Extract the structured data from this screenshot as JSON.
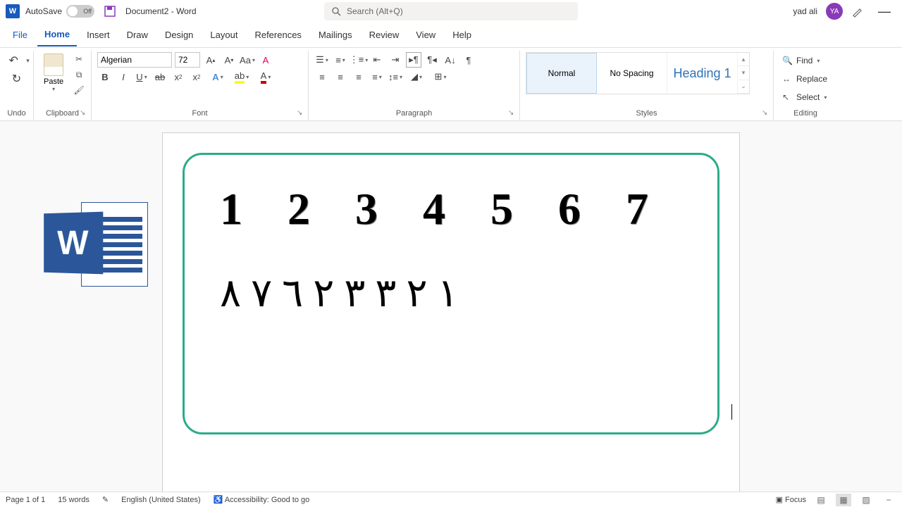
{
  "titlebar": {
    "autosave_label": "AutoSave",
    "autosave_state": "Off",
    "doc_title": "Document2  -  Word",
    "search_placeholder": "Search (Alt+Q)",
    "username": "yad ali",
    "avatar_initials": "YA"
  },
  "tabs": {
    "file": "File",
    "home": "Home",
    "insert": "Insert",
    "draw": "Draw",
    "design": "Design",
    "layout": "Layout",
    "references": "References",
    "mailings": "Mailings",
    "review": "Review",
    "view": "View",
    "help": "Help"
  },
  "ribbon": {
    "undo_label": "Undo",
    "clipboard_label": "Clipboard",
    "paste_label": "Paste",
    "font_label": "Font",
    "font_name": "Algerian",
    "font_size": "72",
    "paragraph_label": "Paragraph",
    "styles_label": "Styles",
    "style_normal": "Normal",
    "style_nospacing": "No Spacing",
    "style_heading1": "Heading 1",
    "editing_label": "Editing",
    "find": "Find",
    "replace": "Replace",
    "select": "Select"
  },
  "document": {
    "line1": "1 2 3 4 5 6 7",
    "line2": "١ ٢ ٣ ٣ ٢ ٦ ٧ ٨",
    "logo_letter": "W"
  },
  "statusbar": {
    "page": "Page 1 of 1",
    "words": "15 words",
    "language": "English (United States)",
    "accessibility": "Accessibility: Good to go",
    "focus": "Focus"
  }
}
